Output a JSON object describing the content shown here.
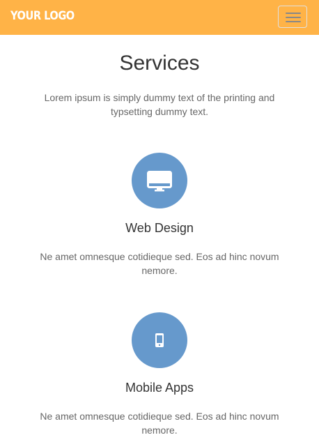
{
  "navbar": {
    "logo_text": "YOUR LOGO",
    "brand_color": "#ffb347"
  },
  "services": {
    "title": "Services",
    "intro": "Lorem ipsum is simply dummy text of the printing and typsetting dummy text.",
    "accent_color": "#6699cc",
    "items": [
      {
        "icon": "desktop-monitor-icon",
        "title": "Web Design",
        "text": "Ne amet omnesque cotidieque sed. Eos ad hinc novum nemore."
      },
      {
        "icon": "mobile-phone-icon",
        "title": "Mobile Apps",
        "text": "Ne amet omnesque cotidieque sed. Eos ad hinc novum nemore."
      }
    ]
  }
}
